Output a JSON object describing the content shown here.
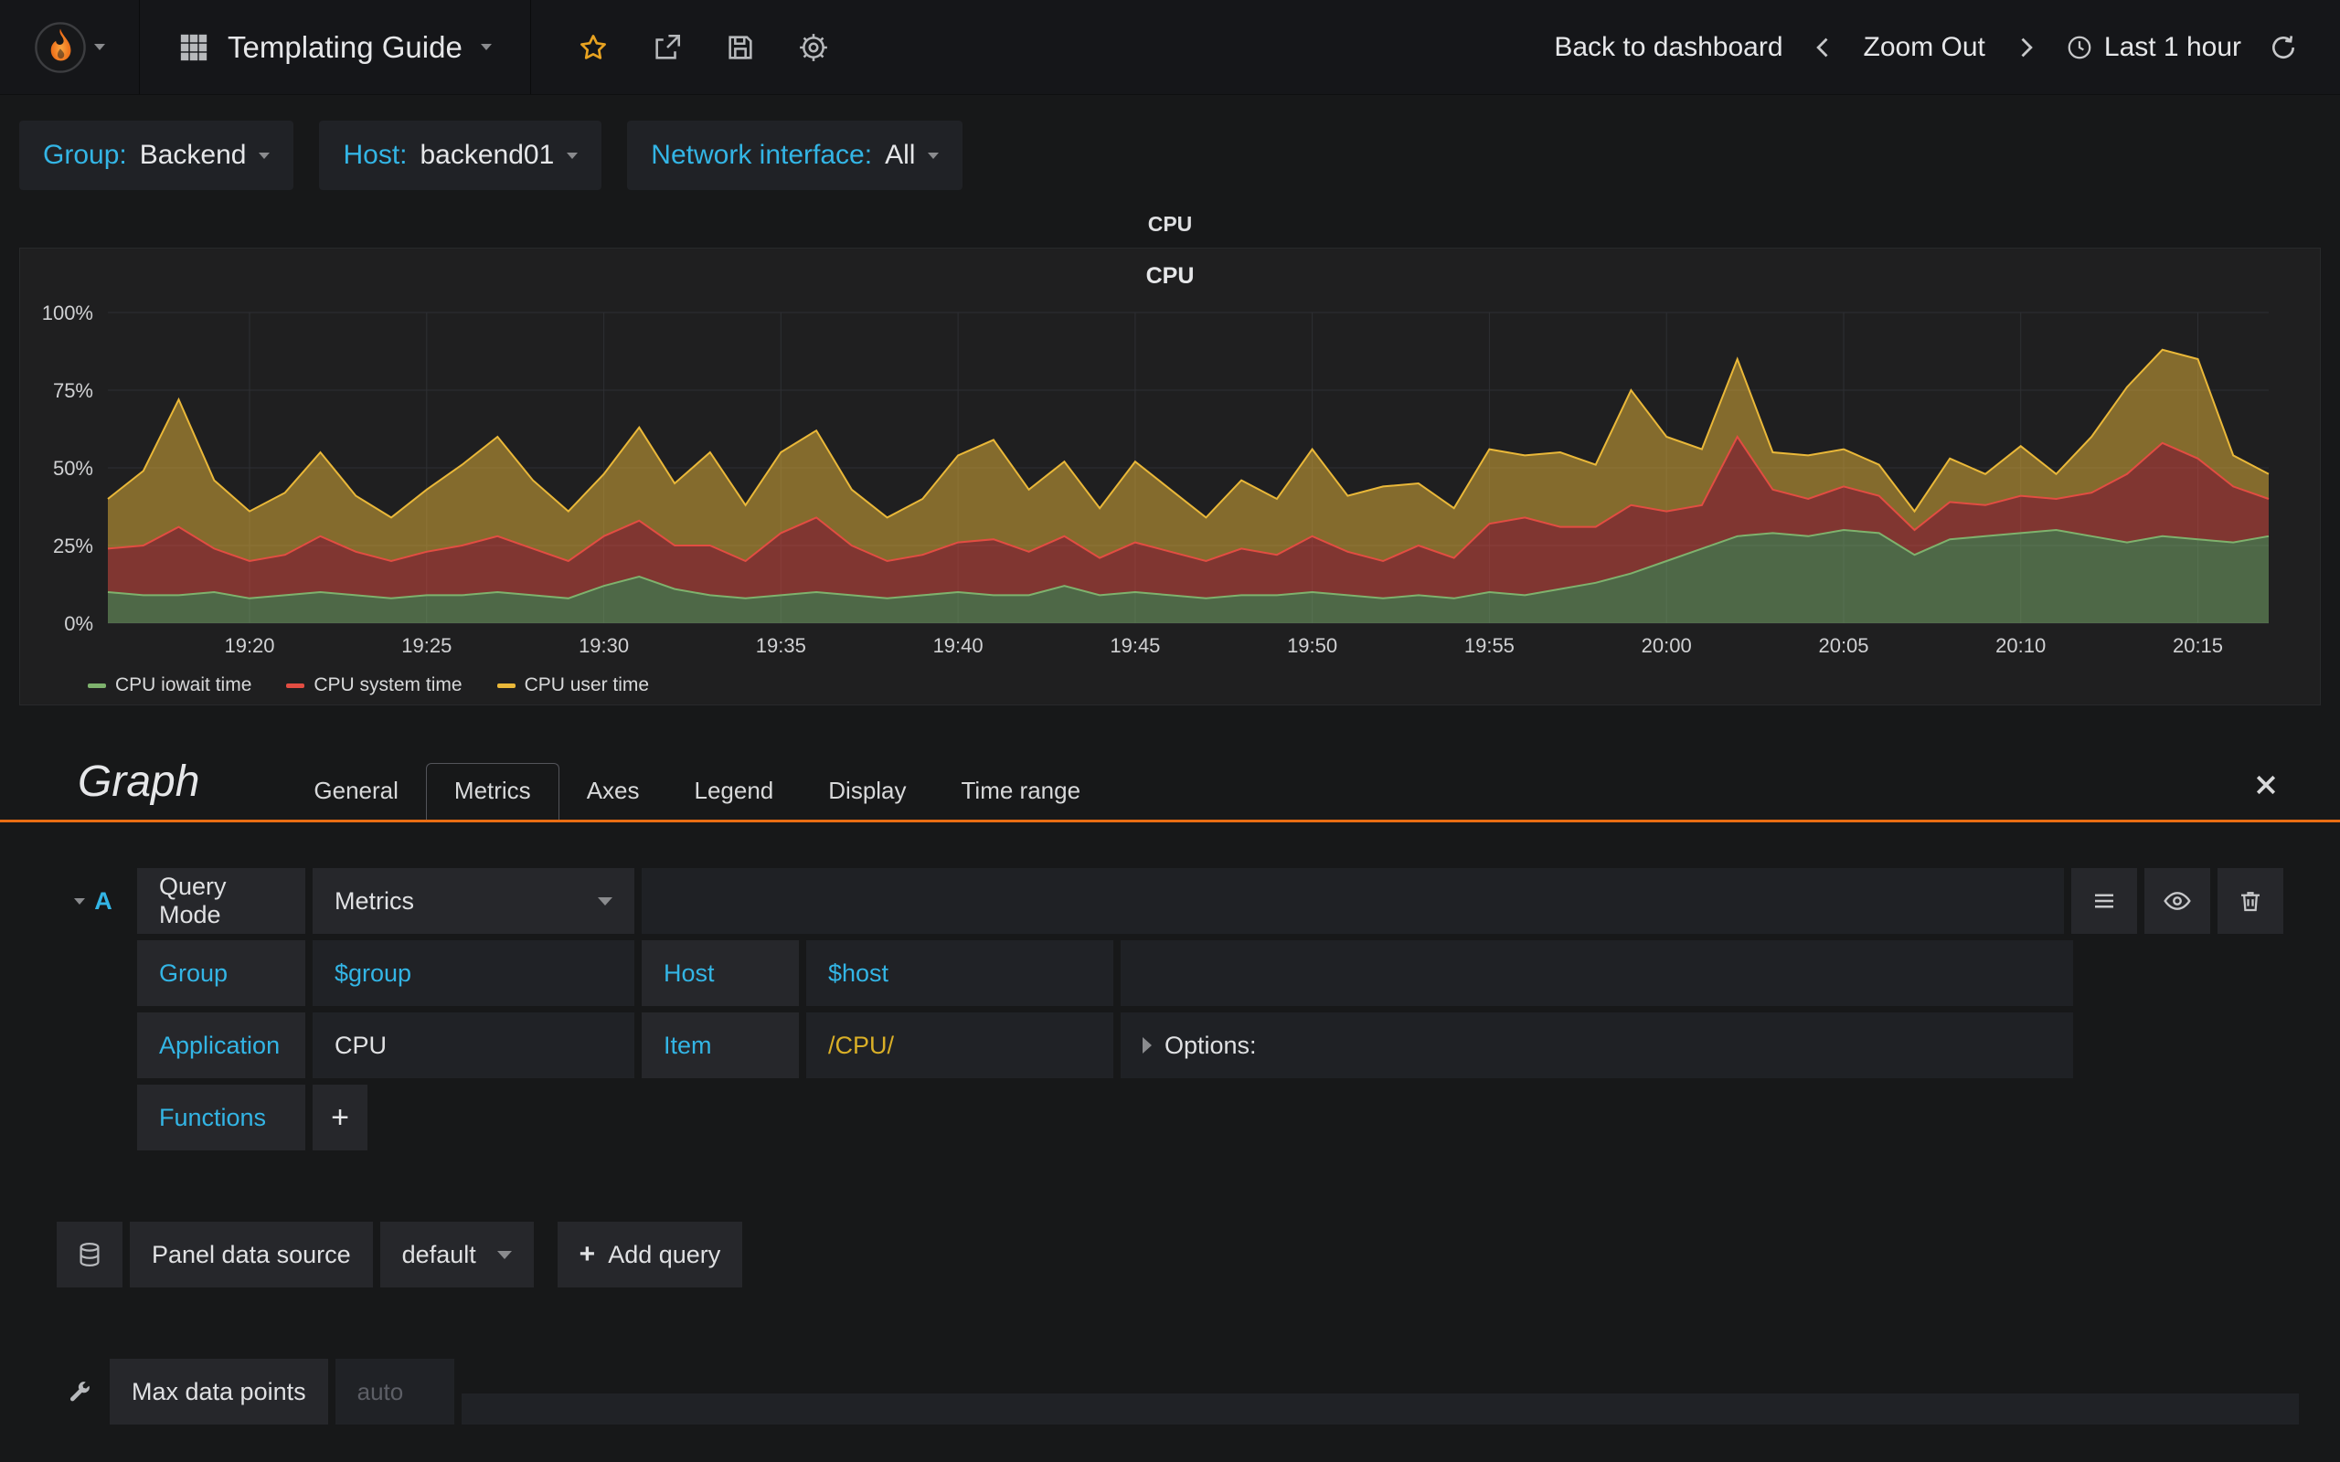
{
  "navbar": {
    "title": "Templating Guide",
    "back_to_dashboard": "Back to dashboard",
    "zoom_out": "Zoom Out",
    "time_range": "Last 1 hour"
  },
  "icons": {
    "logo": "grafana-flame",
    "dashboard_title": "grid",
    "favorite": "star-outline",
    "share": "share-arrow",
    "save": "floppy-disk",
    "settings": "gear",
    "prev_range": "chevron-left",
    "next_range": "chevron-right",
    "clock": "clock",
    "refresh": "circular-arrow",
    "collapse_query": "caret-down",
    "options_expand": "caret-right",
    "query_menu": "hamburger",
    "toggle_visibility": "eye",
    "delete_query": "trash",
    "datasource": "database-cylinder",
    "metrics_options": "wrench",
    "close_editor": "x"
  },
  "variables": [
    {
      "label": "Group:",
      "value": "Backend"
    },
    {
      "label": "Host:",
      "value": "backend01"
    },
    {
      "label": "Network interface:",
      "value": "All"
    }
  ],
  "panel": {
    "row_title": "CPU",
    "title": "CPU"
  },
  "chart_data": {
    "type": "area",
    "stacked": true,
    "title": "CPU",
    "xlabel": "",
    "ylabel": "",
    "ylim": [
      0,
      100
    ],
    "grid": true,
    "legend_position": "bottom-left",
    "y_ticks": [
      {
        "value": 0,
        "label": "0%"
      },
      {
        "value": 25,
        "label": "25%"
      },
      {
        "value": 50,
        "label": "50%"
      },
      {
        "value": 75,
        "label": "75%"
      },
      {
        "value": 100,
        "label": "100%"
      }
    ],
    "x_ticks": [
      "19:20",
      "19:25",
      "19:30",
      "19:35",
      "19:40",
      "19:45",
      "19:50",
      "19:55",
      "20:00",
      "20:05",
      "20:10",
      "20:15"
    ],
    "x_times": [
      "19:16",
      "19:17",
      "19:18",
      "19:19",
      "19:20",
      "19:21",
      "19:22",
      "19:23",
      "19:24",
      "19:25",
      "19:26",
      "19:27",
      "19:28",
      "19:29",
      "19:30",
      "19:31",
      "19:32",
      "19:33",
      "19:34",
      "19:35",
      "19:36",
      "19:37",
      "19:38",
      "19:39",
      "19:40",
      "19:41",
      "19:42",
      "19:43",
      "19:44",
      "19:45",
      "19:46",
      "19:47",
      "19:48",
      "19:49",
      "19:50",
      "19:51",
      "19:52",
      "19:53",
      "19:54",
      "19:55",
      "19:56",
      "19:57",
      "19:58",
      "19:59",
      "20:00",
      "20:01",
      "20:02",
      "20:03",
      "20:04",
      "20:05",
      "20:06",
      "20:07",
      "20:08",
      "20:09",
      "20:10",
      "20:11",
      "20:12",
      "20:13",
      "20:14",
      "20:15",
      "20:16",
      "20:17"
    ],
    "series": [
      {
        "name": "CPU iowait time",
        "color": "#7eb26d",
        "values": [
          10,
          9,
          9,
          10,
          8,
          9,
          10,
          9,
          8,
          9,
          9,
          10,
          9,
          8,
          12,
          15,
          11,
          9,
          8,
          9,
          10,
          9,
          8,
          9,
          10,
          9,
          9,
          12,
          9,
          10,
          9,
          8,
          9,
          9,
          10,
          9,
          8,
          9,
          8,
          10,
          9,
          11,
          13,
          16,
          20,
          24,
          28,
          29,
          28,
          30,
          29,
          22,
          27,
          28,
          29,
          30,
          28,
          26,
          28,
          27,
          26,
          28
        ]
      },
      {
        "name": "CPU system time",
        "color": "#e24d42",
        "values": [
          14,
          16,
          22,
          14,
          12,
          13,
          18,
          14,
          12,
          14,
          16,
          18,
          15,
          12,
          16,
          18,
          14,
          16,
          12,
          20,
          24,
          16,
          12,
          13,
          16,
          18,
          14,
          16,
          12,
          16,
          14,
          12,
          15,
          13,
          18,
          14,
          12,
          16,
          13,
          22,
          25,
          20,
          18,
          22,
          16,
          14,
          32,
          14,
          12,
          14,
          12,
          8,
          12,
          10,
          12,
          10,
          14,
          22,
          30,
          26,
          18,
          12
        ]
      },
      {
        "name": "CPU user time",
        "color": "#eab839",
        "values": [
          16,
          24,
          41,
          22,
          16,
          20,
          27,
          18,
          14,
          20,
          26,
          32,
          22,
          16,
          20,
          30,
          20,
          30,
          18,
          26,
          28,
          18,
          14,
          18,
          28,
          32,
          20,
          24,
          16,
          26,
          20,
          14,
          22,
          18,
          28,
          18,
          24,
          20,
          16,
          24,
          20,
          24,
          20,
          37,
          24,
          18,
          25,
          12,
          14,
          12,
          10,
          6,
          14,
          10,
          16,
          8,
          18,
          28,
          30,
          32,
          10,
          8
        ]
      }
    ]
  },
  "editor": {
    "panel_type_title": "Graph",
    "tabs": [
      "General",
      "Metrics",
      "Axes",
      "Legend",
      "Display",
      "Time range"
    ],
    "active_tab": "Metrics",
    "query": {
      "ref_id": "A",
      "query_mode_label": "Query Mode",
      "query_mode_value": "Metrics",
      "group_label": "Group",
      "group_value": "$group",
      "host_label": "Host",
      "host_value": "$host",
      "application_label": "Application",
      "application_value": "CPU",
      "item_label": "Item",
      "item_value": "/CPU/",
      "options_label": "Options:",
      "functions_label": "Functions",
      "add_function_label": "+"
    },
    "datasource": {
      "label": "Panel data source",
      "value": "default",
      "add_query_plus": "+",
      "add_query_label": "Add query"
    },
    "max_data_points": {
      "label": "Max data points",
      "placeholder": "auto"
    }
  },
  "colors": {
    "accent_blue": "#33b5e5",
    "accent_orange": "#e96d13",
    "item_value_yellow": "#d9af27",
    "series_green": "#7eb26d",
    "series_red": "#e24d42",
    "series_yellow": "#eab839"
  }
}
